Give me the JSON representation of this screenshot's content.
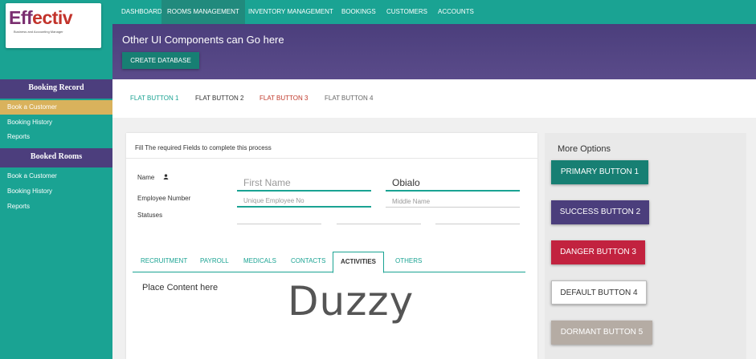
{
  "logo": {
    "text_first": "Eff",
    "text_rest": "ectiv",
    "subtitle": "Business and Accounting Manager"
  },
  "nav": {
    "items": [
      {
        "label": "DASHBOARD"
      },
      {
        "label": "ROOMS MANAGEMENT"
      },
      {
        "label": "INVENTORY MANAGEMENT"
      },
      {
        "label": "BOOKINGS"
      },
      {
        "label": "CUSTOMERS"
      },
      {
        "label": "ACCOUNTS"
      }
    ],
    "active": "ROOMS MANAGEMENT"
  },
  "banner": {
    "title": "Other UI Components can Go here",
    "button": "CREATE DATABASE"
  },
  "sidebar": {
    "section1": {
      "title": "Booking Record",
      "items": [
        "Book a Customer",
        "Booking History",
        "Reports"
      ]
    },
    "section2": {
      "title": "Booked Rooms",
      "items": [
        "Book a Customer",
        "Booking History",
        "Reports"
      ]
    }
  },
  "flat_buttons": [
    {
      "label": "FLAT BUTTON 1",
      "color": "#1aa393"
    },
    {
      "label": "FLAT BUTTON 2",
      "color": "#333333"
    },
    {
      "label": "FLAT BUTTON 3",
      "color": "#c0392b"
    },
    {
      "label": "FLAT BUTTON 4",
      "color": "#666666"
    }
  ],
  "form": {
    "heading": "Fill The required Fields to complete this process",
    "labels": {
      "name": "Name",
      "employee_number": "Employee Number",
      "statuses": "Statuses"
    },
    "fields": {
      "first_name_placeholder": "First Name",
      "last_name_value": "Obialo",
      "employee_no_placeholder": "Unique Employee No",
      "middle_name_placeholder": "Middle Name"
    },
    "tabs": [
      "RECRUITMENT",
      "PAYROLL",
      "MEDICALS",
      "CONTACTS",
      "ACTIVITIES",
      "OTHERS"
    ],
    "active_tab": "ACTIVITIES",
    "content": "Place Content here",
    "watermark": "Duzzy"
  },
  "options": {
    "title": "More Options",
    "buttons": [
      {
        "label": "PRIMARY BUTTON 1",
        "color": "#177f73"
      },
      {
        "label": "SUCCESS BUTTON 2",
        "color": "#4b3e7c"
      },
      {
        "label": "DANGER BUTTON 3",
        "color": "#c2223f"
      },
      {
        "label": "DEFAULT BUTTON 4",
        "color": "#ffffff"
      },
      {
        "label": "DORMANT BUTTON 5",
        "color": "#b5aca4"
      }
    ]
  },
  "icons": {
    "person": "person-icon"
  },
  "colors": {
    "teal": "#1aa393",
    "purple": "#4b3e7c",
    "gold": "#d9b25c"
  }
}
